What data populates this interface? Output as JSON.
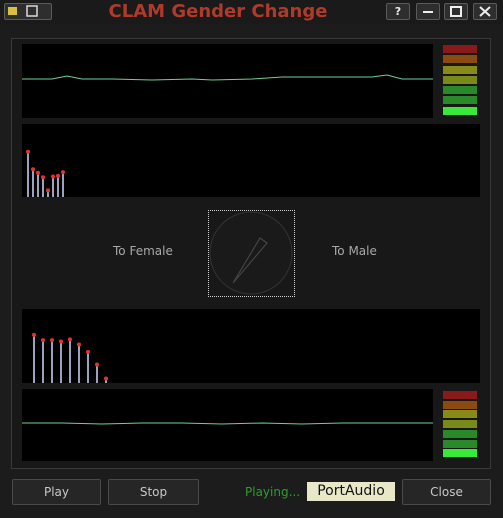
{
  "window": {
    "title": "CLAM Gender Change",
    "controls": {
      "help": "?",
      "minimize": "–",
      "maximize": "□",
      "close": "✕"
    }
  },
  "labels": {
    "to_female": "To Female",
    "to_male": "To Male"
  },
  "buttons": {
    "play": "Play",
    "stop": "Stop",
    "close": "Close"
  },
  "status": {
    "playing": "Playing...",
    "backend": "PortAudio"
  },
  "colors": {
    "accent_title": "#b03a2a",
    "waveform": "#6fd09a",
    "peak_marker": "#e83030",
    "status_green": "#2aa02a",
    "meter_levels": [
      "#8a1a1a",
      "#8a4a10",
      "#8a8a18",
      "#7a8a18",
      "#2a8a2a",
      "#2a8a2a",
      "#3ae83a"
    ]
  },
  "spectrum_input_levels": [
    0.62,
    0.38,
    0.33,
    0.27,
    0.09,
    0.28,
    0.29,
    0.34
  ],
  "spectrum_output_levels": [
    0.65,
    0.58,
    0.58,
    0.56,
    0.59,
    0.52,
    0.42,
    0.25,
    0.06
  ],
  "pitch_dial_fraction": 0.58
}
